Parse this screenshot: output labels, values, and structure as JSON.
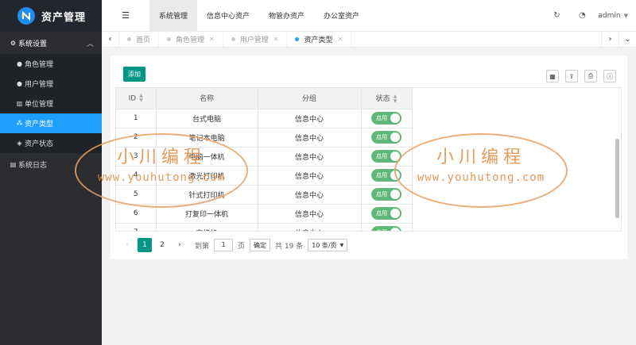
{
  "app": {
    "title": "资产管理"
  },
  "sidebar": {
    "group": {
      "label": "系统设置"
    },
    "items": [
      {
        "label": "角色管理",
        "icon": "user-icon"
      },
      {
        "label": "用户管理",
        "icon": "user-icon"
      },
      {
        "label": "单位管理",
        "icon": "bank-icon"
      },
      {
        "label": "资产类型",
        "icon": "dot-grid-icon",
        "active": true
      },
      {
        "label": "资产状态",
        "icon": "cube-icon"
      }
    ],
    "log": {
      "label": "系统日志"
    }
  },
  "header": {
    "tabs": [
      "系统管理",
      "信息中心资产",
      "物管办资产",
      "办公室资产"
    ],
    "active_tab": "系统管理",
    "user": "admin"
  },
  "tabbar": {
    "tabs": [
      {
        "label": "首页"
      },
      {
        "label": "角色管理"
      },
      {
        "label": "用户管理"
      },
      {
        "label": "资产类型",
        "active": true
      }
    ]
  },
  "toolbar": {
    "add_label": "添加"
  },
  "table": {
    "headers": [
      "ID",
      "名称",
      "分组",
      "状态"
    ],
    "rows": [
      {
        "id": "1",
        "name": "台式电脑",
        "group": "信息中心",
        "status": "启用"
      },
      {
        "id": "2",
        "name": "笔记本电脑",
        "group": "信息中心",
        "status": "启用"
      },
      {
        "id": "3",
        "name": "电脑一体机",
        "group": "信息中心",
        "status": "启用"
      },
      {
        "id": "4",
        "name": "激光打印机",
        "group": "信息中心",
        "status": "启用"
      },
      {
        "id": "5",
        "name": "针式打印机",
        "group": "信息中心",
        "status": "启用"
      },
      {
        "id": "6",
        "name": "打复印一体机",
        "group": "信息中心",
        "status": "启用"
      },
      {
        "id": "7",
        "name": "交换机",
        "group": "信息中心",
        "status": "启用"
      }
    ]
  },
  "pager": {
    "pages": [
      "1",
      "2"
    ],
    "current": "1",
    "goto_label": "到第",
    "goto_value": "1",
    "page_unit": "页",
    "confirm": "确定",
    "total": "共 19 条",
    "per_page": "10 条/页"
  },
  "watermark": {
    "line1": "小川编程",
    "line2": "www.youhutong.com"
  },
  "colors": {
    "accent": "#009688",
    "active_menu": "#1e9fff",
    "switch_on": "#5fb878",
    "sidebar": "#2b2d30"
  }
}
